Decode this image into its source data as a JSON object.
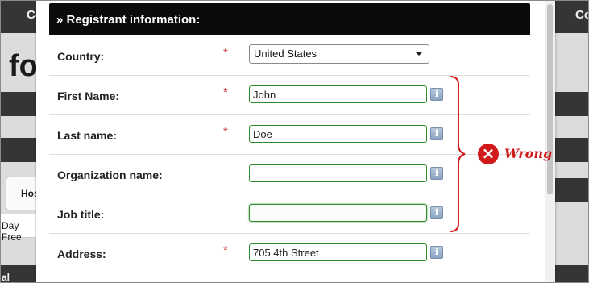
{
  "background_page": {
    "top_left_label": "Co",
    "top_right_label": "Co",
    "heading_fragment": "fo",
    "tab_label": "Hos",
    "left_text": "Day Free",
    "bottom_left_text": "al"
  },
  "modal": {
    "section_title": "» Registrant information:",
    "rows": [
      {
        "label": "Country:",
        "required": "*",
        "select_value": "United States"
      },
      {
        "label": "First Name:",
        "required": "*",
        "value": "John",
        "info": "i"
      },
      {
        "label": "Last name:",
        "required": "*",
        "value": "Doe",
        "info": "i"
      },
      {
        "label": "Organization name:",
        "value": "",
        "info": "i"
      },
      {
        "label": "Job title:",
        "value": "",
        "info": "i"
      },
      {
        "label": "Address:",
        "required": "*",
        "value": "705 4th Street",
        "info": "i"
      }
    ]
  },
  "annotation": {
    "icon": "x-circle-icon",
    "label": "Wrong",
    "color": "#d11b1b"
  },
  "colors": {
    "valid_border": "#2e8b2e",
    "required_star": "#cc2b2b",
    "header_bg": "#0b0b0b"
  }
}
